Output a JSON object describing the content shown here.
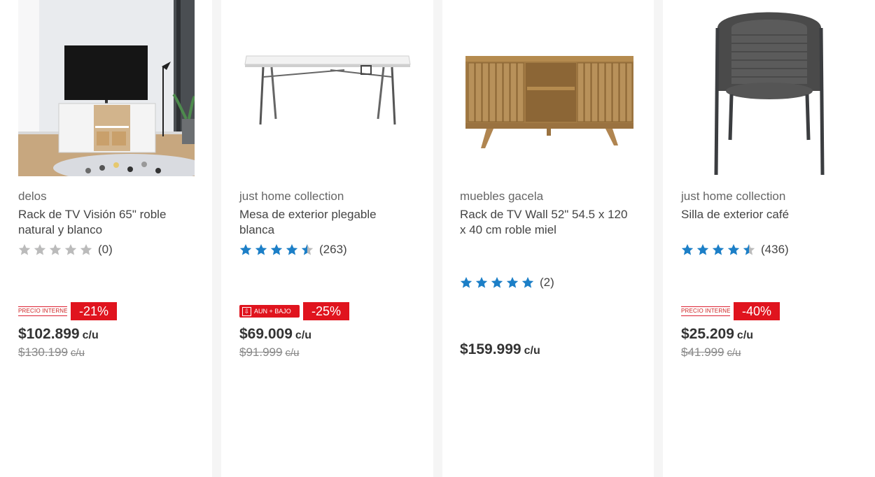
{
  "colors": {
    "star_filled": "#1c7fc7",
    "star_empty": "#bbbbbb",
    "discount_bg": "#e0141e",
    "card_bg": "#ffffff",
    "page_bg": "#f5f5f5"
  },
  "products": [
    {
      "brand": "delos",
      "title": "Rack de TV Visión 65\" roble natural y blanco",
      "rating": 0,
      "rating_count": "(0)",
      "badge_label": "PRECIO INTERNET",
      "discount": "-21%",
      "price": "$102.899",
      "unit": "c/u",
      "old_price": "$130.199",
      "old_unit": "c/u",
      "image_icon": "tv-stand-room-photo"
    },
    {
      "brand": "just home collection",
      "title": "Mesa de exterior plegable blanca",
      "rating": 4.5,
      "rating_count": "(263)",
      "badge_label": "AUN + BAJO",
      "discount": "-25%",
      "price": "$69.009",
      "unit": "c/u",
      "old_price": "$91.999",
      "old_unit": "c/u",
      "image_icon": "folding-table-photo"
    },
    {
      "brand": "muebles gacela",
      "title": "Rack de TV Wall 52\" 54.5 x 120 x 40 cm roble miel",
      "rating": 5,
      "rating_count": "(2)",
      "price": "$159.999",
      "unit": "c/u",
      "image_icon": "wooden-tv-cabinet-photo"
    },
    {
      "brand": "just home collection",
      "title": "Silla de exterior café",
      "rating": 4.5,
      "rating_count": "(436)",
      "badge_label": "PRECIO INTERNET",
      "discount": "-40%",
      "price": "$25.209",
      "unit": "c/u",
      "old_price": "$41.999",
      "old_unit": "c/u",
      "image_icon": "wicker-chair-photo"
    }
  ]
}
